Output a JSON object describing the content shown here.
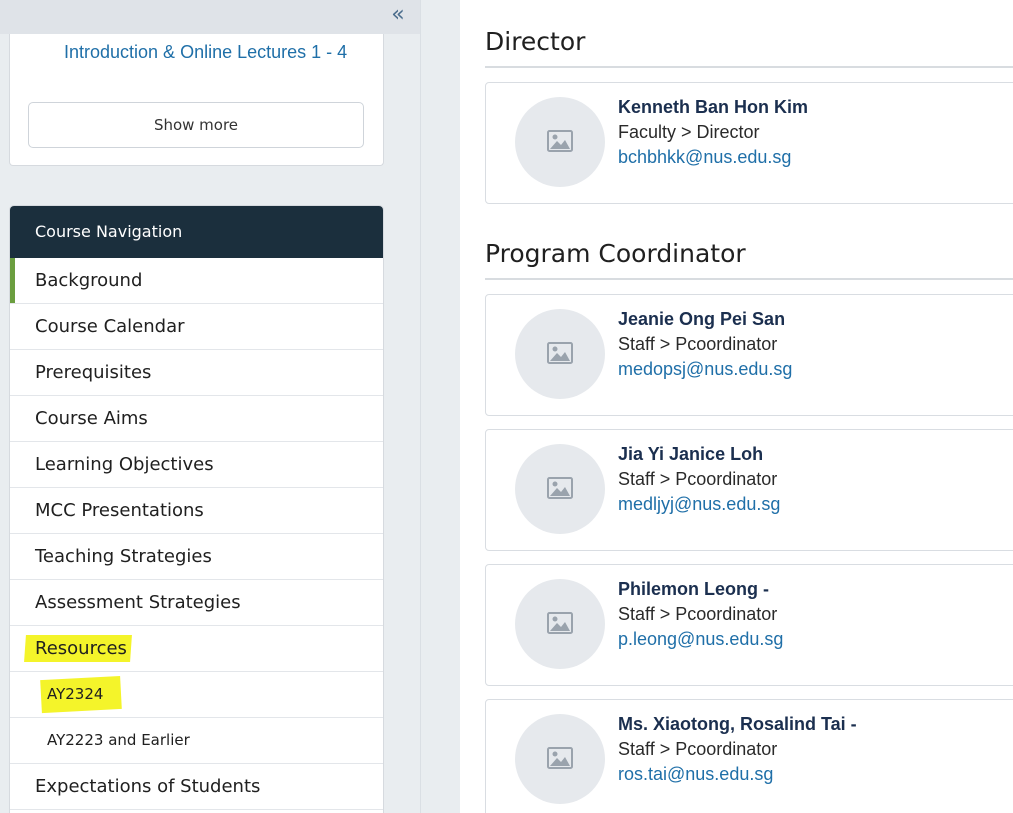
{
  "sidebar": {
    "collapse_icon": "double-chevron-left-icon",
    "collapse_glyph": "«",
    "top_card": {
      "link_text": "Introduction & Online Lectures 1 - 4",
      "show_more": "Show more"
    },
    "nav": {
      "header": "Course Navigation",
      "items": [
        {
          "label": "Background",
          "active": true
        },
        {
          "label": "Course Calendar"
        },
        {
          "label": "Prerequisites"
        },
        {
          "label": "Course Aims"
        },
        {
          "label": "Learning Objectives"
        },
        {
          "label": "MCC Presentations"
        },
        {
          "label": "Teaching Strategies"
        },
        {
          "label": "Assessment Strategies"
        },
        {
          "label": "Resources",
          "highlighted": true
        },
        {
          "label": "AY2324",
          "sub": true,
          "highlighted": true
        },
        {
          "label": "AY2223 and Earlier",
          "sub": true
        },
        {
          "label": "Expectations of Students"
        }
      ]
    },
    "colors": {
      "header_bg": "#1b2f3d",
      "active_marker": "#6b9e3f",
      "highlight": "#f4f42a"
    }
  },
  "main": {
    "sections": [
      {
        "title": "Director",
        "people": [
          {
            "name": "Kenneth Ban Hon Kim",
            "role": "Faculty > Director",
            "email": "bchbhkk@nus.edu.sg"
          }
        ]
      },
      {
        "title": "Program Coordinator",
        "people": [
          {
            "name": "Jeanie Ong Pei San",
            "role": "Staff > Pcoordinator",
            "email": "medopsj@nus.edu.sg"
          },
          {
            "name": "Jia Yi Janice Loh",
            "role": "Staff > Pcoordinator",
            "email": "medljyj@nus.edu.sg"
          },
          {
            "name": "Philemon Leong -",
            "role": "Staff > Pcoordinator",
            "email": "p.leong@nus.edu.sg"
          },
          {
            "name": "Ms. Xiaotong, Rosalind Tai -",
            "role": "Staff > Pcoordinator",
            "email": "ros.tai@nus.edu.sg"
          }
        ]
      }
    ],
    "avatar_icon": "image-placeholder-icon",
    "colors": {
      "link": "#1f6fa8",
      "name": "#1b2f4f"
    }
  }
}
